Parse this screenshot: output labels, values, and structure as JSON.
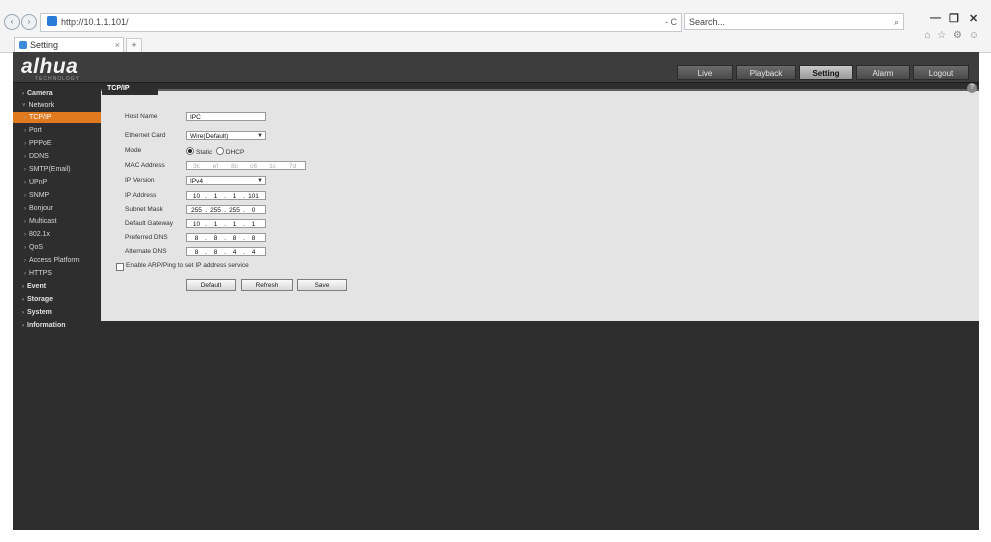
{
  "browser": {
    "url": "http://10.1.1.101/",
    "url_suffix": "- C",
    "search_placeholder": "Search...",
    "search_icon": "magnifier-icon",
    "tab_title": "Setting",
    "tab_close": "×",
    "new_tab": "+",
    "back": "‹",
    "forward": "›",
    "minimize": "—",
    "maximize": "❐",
    "close": "✕",
    "tool_icons": "⌂ ☆ ⚙ ☺"
  },
  "app": {
    "logo": "alhua",
    "logo_sub": "TECHNOLOGY",
    "topnav": [
      "Live",
      "Playback",
      "Setting",
      "Alarm",
      "Logout"
    ],
    "topnav_active": "Setting"
  },
  "sidebar": {
    "camera": "Camera",
    "network": "Network",
    "network_items": [
      "TCP/IP",
      "Port",
      "PPPoE",
      "DDNS",
      "SMTP(Email)",
      "UPnP",
      "SNMP",
      "Bonjour",
      "Multicast",
      "802.1x",
      "QoS",
      "Access Platform",
      "HTTPS"
    ],
    "event": "Event",
    "storage": "Storage",
    "system": "System",
    "information": "Information"
  },
  "content": {
    "tab": "TCP/IP",
    "help": "?",
    "labels": {
      "host_name": "Host Name",
      "ethernet_card": "Ethernet Card",
      "mode": "Mode",
      "mac_address": "MAC Address",
      "ip_version": "IP Version",
      "ip_address": "IP Address",
      "subnet_mask": "Subnet Mask",
      "default_gateway": "Default Gateway",
      "preferred_dns": "Preferred DNS",
      "alternate_dns": "Alternate DNS"
    },
    "values": {
      "host_name": "IPC",
      "ethernet_card": "Wire(Default)",
      "mode_static": "Static",
      "mode_dhcp": "DHCP",
      "mode_selected": "Static",
      "mac": [
        "3c",
        "ef",
        "8c",
        "c6",
        "1c",
        "7d"
      ],
      "ip_version": "IPv4",
      "ip_address": [
        "10",
        "1",
        "1",
        "101"
      ],
      "subnet_mask": [
        "255",
        "255",
        "255",
        "0"
      ],
      "default_gateway": [
        "10",
        "1",
        "1",
        "1"
      ],
      "preferred_dns": [
        "8",
        "8",
        "8",
        "8"
      ],
      "alternate_dns": [
        "8",
        "8",
        "4",
        "4"
      ]
    },
    "arp_ping_label": "Enable ARP/Ping to set IP address service",
    "arp_ping_checked": false,
    "buttons": {
      "default": "Default",
      "refresh": "Refresh",
      "save": "Save"
    }
  }
}
